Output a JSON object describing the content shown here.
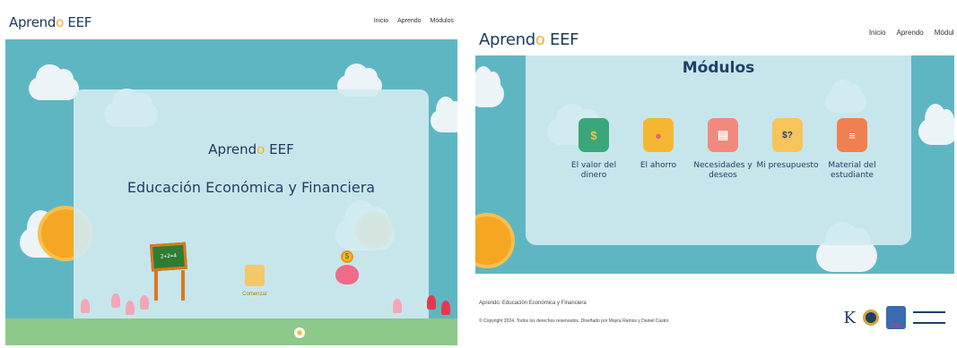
{
  "brand": {
    "name_part1": "Aprend",
    "name_part2": "o",
    "name_part3": " EEF"
  },
  "nav": {
    "items": [
      "Inicio",
      "Aprendo",
      "Módulos"
    ]
  },
  "hero": {
    "title": "Educación Económica y Financiera",
    "start_label": "Comenzar"
  },
  "modules": {
    "title": "Módulos",
    "items": [
      {
        "label": "El valor del dinero",
        "icon": "coin-icon",
        "color": "#3aa77a",
        "glyph": "$"
      },
      {
        "label": "El ahorro",
        "icon": "piggy-bank-icon",
        "color": "#f5b732",
        "glyph": "●"
      },
      {
        "label": "Necesidades y deseos",
        "icon": "document-icon",
        "color": "#f08a7e",
        "glyph": "▤"
      },
      {
        "label": "Mi presupuesto",
        "icon": "budget-icon",
        "color": "#f7c45c",
        "glyph": "$?"
      },
      {
        "label": "Material del estudiante",
        "icon": "book-stack-icon",
        "color": "#f0804f",
        "glyph": "≡"
      }
    ]
  },
  "footer": {
    "line1": "Aprendo: Educación Económica y Financiera",
    "line2": "© Copyright 2024. Todos los derechos reservados. Diseñado por Mayra Ramos y Daniel Castro"
  },
  "partners": [
    "K",
    "seal",
    "m²",
    "logo"
  ],
  "colors": {
    "sky": "#5fb6c3",
    "panel": "#d0eaf0",
    "brand_dark": "#1a3a5c",
    "brand_accent": "#f2b135"
  }
}
